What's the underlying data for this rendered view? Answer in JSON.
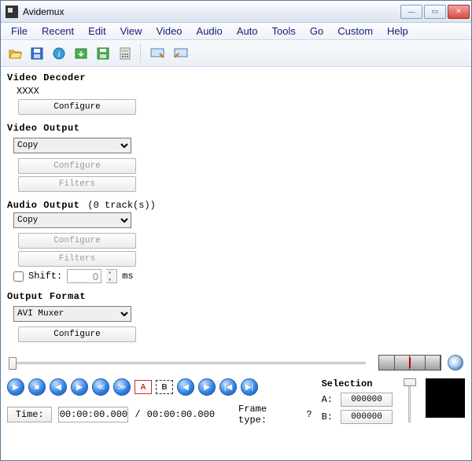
{
  "window": {
    "title": "Avidemux"
  },
  "menu": {
    "items": [
      "File",
      "Recent",
      "Edit",
      "View",
      "Video",
      "Audio",
      "Auto",
      "Tools",
      "Go",
      "Custom",
      "Help"
    ]
  },
  "toolbar": {
    "icons": [
      "open-icon",
      "save-icon",
      "info-icon",
      "load-project-icon",
      "save-project-icon",
      "calculator-icon",
      "sep",
      "monitor-a-icon",
      "monitor-b-icon"
    ]
  },
  "video_decoder": {
    "title": "Video Decoder",
    "codec": "XXXX",
    "configure": "Configure"
  },
  "video_output": {
    "title": "Video Output",
    "value": "Copy",
    "configure": "Configure",
    "filters": "Filters"
  },
  "audio_output": {
    "title": "Audio Output",
    "tracks": "(0 track(s))",
    "value": "Copy",
    "configure": "Configure",
    "filters": "Filters",
    "shift_label": "Shift:",
    "shift_value": "0",
    "shift_unit": "ms"
  },
  "output_format": {
    "title": "Output Format",
    "value": "AVI Muxer",
    "configure": "Configure"
  },
  "selection": {
    "title": "Selection",
    "a_label": "A:",
    "a_value": "000000",
    "b_label": "B:",
    "b_value": "000000"
  },
  "time": {
    "button": "Time:",
    "current": "00:00:00.000",
    "sep": "/",
    "total": "00:00:00.000",
    "frametype_label": "Frame type:",
    "frametype_value": "?"
  }
}
